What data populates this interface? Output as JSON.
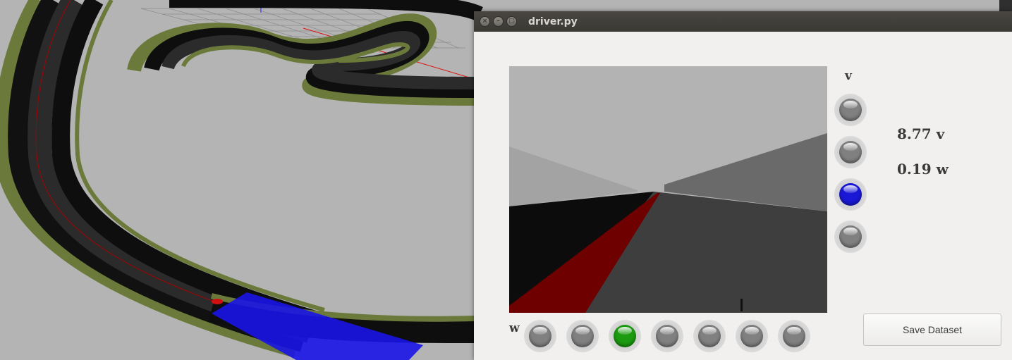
{
  "window": {
    "title": "driver.py"
  },
  "velocity": {
    "v_label": "v",
    "w_label": "w",
    "v_leds": [
      "off",
      "off",
      "active",
      "off"
    ],
    "w_leds": [
      "off",
      "off",
      "active",
      "off",
      "off",
      "off",
      "off"
    ],
    "v_value": "8.77 v",
    "w_value": "0.19 w"
  },
  "buttons": {
    "save": "Save Dataset"
  },
  "colors": {
    "led_off": "#808080",
    "v_active": "#1a18d6",
    "w_active": "#1c9a10",
    "lane_line": "#6e0000"
  }
}
